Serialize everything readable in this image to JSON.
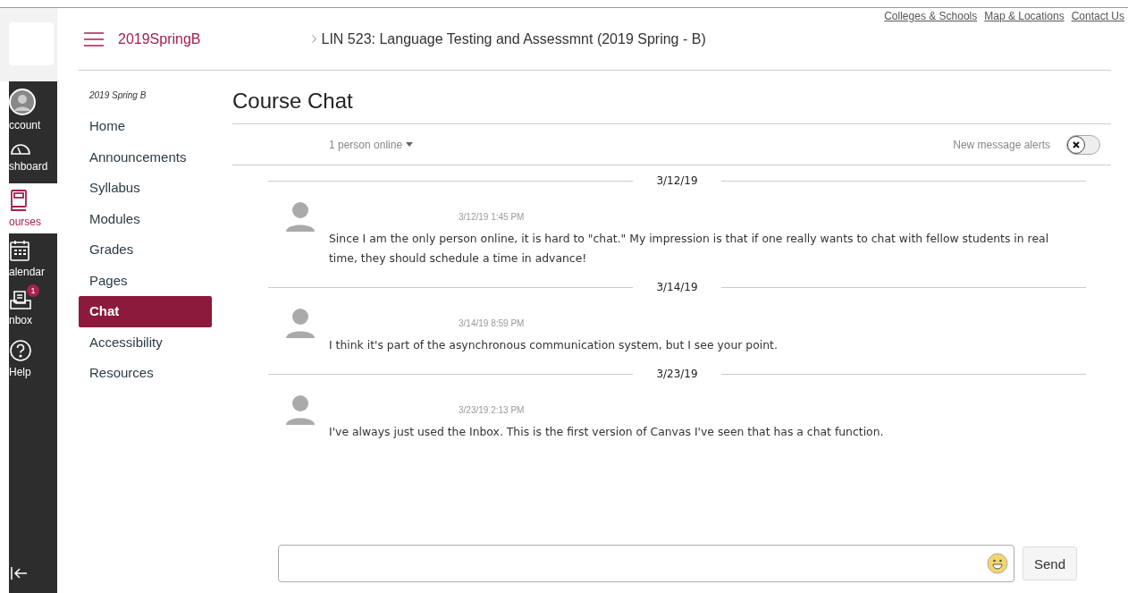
{
  "top_links": [
    "Colleges & Schools",
    "Map & Locations",
    "Contact Us"
  ],
  "global_nav": [
    {
      "label": "ccount",
      "kind": "avatar",
      "selected": false
    },
    {
      "label": "shboard",
      "kind": "gauge",
      "selected": false
    },
    {
      "label": "ourses",
      "kind": "book",
      "selected": true
    },
    {
      "label": "alendar",
      "kind": "calendar",
      "selected": false
    },
    {
      "label": "nbox",
      "kind": "inbox",
      "selected": false,
      "badge": "1"
    },
    {
      "label": "Help",
      "kind": "help",
      "selected": false
    }
  ],
  "header": {
    "course_code": "2019SpringB",
    "breadcrumb": "LIN 523: Language Testing and Assessmnt (2019 Spring - B)"
  },
  "course_nav": {
    "term": "2019 Spring B",
    "items": [
      {
        "label": "Home",
        "selected": false
      },
      {
        "label": "Announcements",
        "selected": false
      },
      {
        "label": "Syllabus",
        "selected": false
      },
      {
        "label": "Modules",
        "selected": false
      },
      {
        "label": "Grades",
        "selected": false
      },
      {
        "label": "Pages",
        "selected": false
      },
      {
        "label": "Chat",
        "selected": true
      },
      {
        "label": "Accessibility",
        "selected": false
      },
      {
        "label": "Resources",
        "selected": false
      }
    ]
  },
  "page_title": "Course Chat",
  "chat": {
    "online": "1 person online",
    "alerts_label": "New message alerts",
    "alerts_on": false,
    "days": [
      {
        "date": "3/12/19",
        "messages": [
          {
            "time": "3/12/19 1:45 PM",
            "text": "Since I am the only person online, it is hard to \"chat.\" My impression is that if one really wants to chat with fellow students in real time, they should schedule a time in advance!"
          }
        ]
      },
      {
        "date": "3/14/19",
        "messages": [
          {
            "time": "3/14/19 8:59 PM",
            "text": "I think it's part of the asynchronous communication system, but I see your point."
          }
        ]
      },
      {
        "date": "3/23/19",
        "messages": [
          {
            "time": "3/23/19 2:13 PM",
            "text": "I've always just used the Inbox. This is the first version of Canvas I've seen that has a chat function."
          }
        ]
      }
    ],
    "send": "Send"
  }
}
